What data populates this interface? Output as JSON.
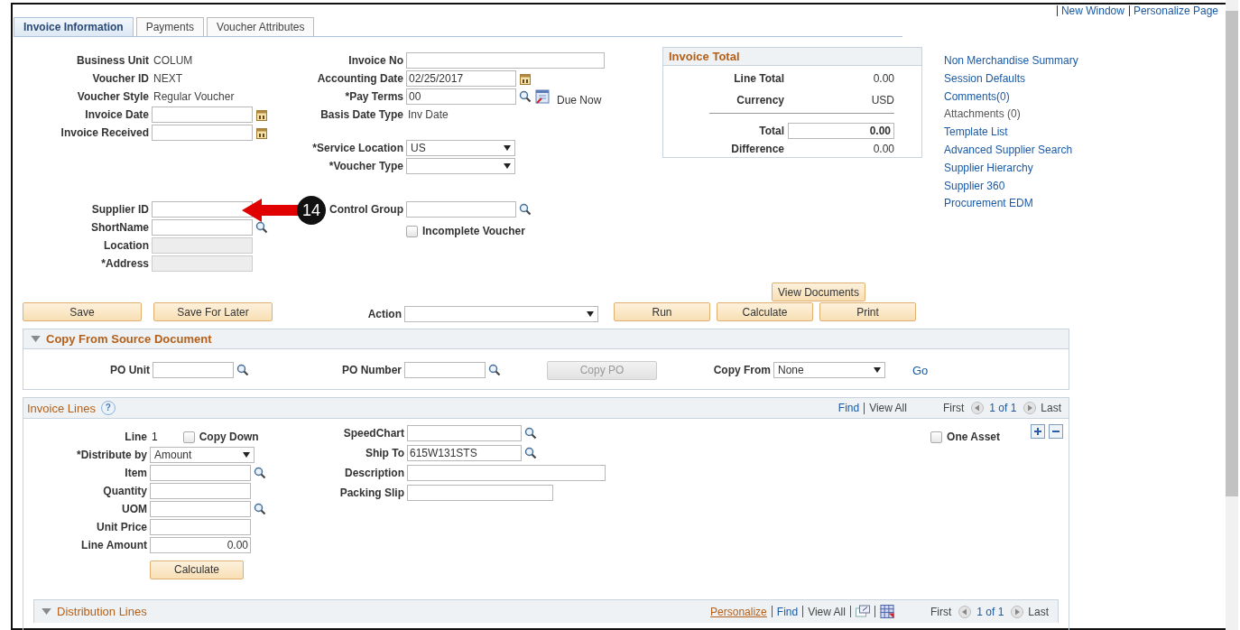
{
  "top_links": [
    "New Window",
    "Personalize Page"
  ],
  "tabs": [
    {
      "label": "Invoice Information",
      "selected": true
    },
    {
      "label": "Payments",
      "selected": false
    },
    {
      "label": "Voucher Attributes",
      "selected": false
    }
  ],
  "header": {
    "columns": [
      {
        "groups": [
          [
            {
              "kind": "text",
              "label": "Business Unit",
              "value": "COLUM"
            },
            {
              "kind": "text",
              "label": "Voucher ID",
              "value": "NEXT"
            },
            {
              "kind": "text",
              "label": "Voucher Style",
              "value": "Regular Voucher"
            },
            {
              "kind": "date",
              "label": "Invoice Date"
            },
            {
              "kind": "date",
              "label": "Invoice Received"
            }
          ],
          [
            {
              "kind": "input",
              "label": "Supplier ID"
            },
            {
              "kind": "lookup",
              "label": "ShortName"
            },
            {
              "kind": "disabled",
              "label": "Location"
            },
            {
              "kind": "disabled",
              "label": "*Address"
            }
          ]
        ]
      },
      {
        "groups": [
          [
            {
              "kind": "wide",
              "label": "Invoice No"
            },
            {
              "kind": "date",
              "label": "Accounting Date",
              "value": "02/25/2017"
            },
            {
              "kind": "terms",
              "label": "*Pay Terms",
              "value": "00",
              "note": "Due Now"
            },
            {
              "kind": "text",
              "label": "Basis Date Type",
              "value": "Inv Date"
            }
          ],
          [
            {
              "kind": "select",
              "label": "*Service Location",
              "value": "US"
            },
            {
              "kind": "select",
              "label": "*Voucher Type"
            }
          ],
          [
            {
              "kind": "lookup",
              "label": "Control Group"
            },
            {
              "kind": "checkbox",
              "label": "Incomplete Voucher",
              "checked": false
            }
          ]
        ]
      }
    ]
  },
  "invoice_total": {
    "title": "Invoice Total",
    "rows": [
      {
        "kind": "text",
        "label": "Line Total",
        "value": "0.00"
      },
      {
        "kind": "text",
        "label": "Currency",
        "value": "USD"
      },
      {
        "kind": "input",
        "label": "Total",
        "value": "0.00"
      },
      {
        "kind": "text",
        "label": "Difference",
        "value": "0.00"
      }
    ]
  },
  "side_links": [
    {
      "label": "Non Merchandise Summary",
      "disabled": false
    },
    {
      "label": "Session Defaults",
      "disabled": false
    },
    {
      "label": "Comments(0)",
      "disabled": false
    },
    {
      "label": "Attachments (0)",
      "disabled": true
    },
    {
      "label": "Template List",
      "disabled": false
    },
    {
      "label": "Advanced Supplier Search",
      "disabled": false
    },
    {
      "label": "Supplier Hierarchy",
      "disabled": false
    },
    {
      "label": "Supplier 360",
      "disabled": false
    },
    {
      "label": "Procurement EDM",
      "disabled": false
    }
  ],
  "actions": {
    "view_documents": "View Documents",
    "left_buttons": [
      "Save",
      "Save For Later"
    ],
    "action_label": "Action",
    "right_buttons": [
      "Run",
      "Calculate",
      "Print"
    ]
  },
  "copy_panel": {
    "title": "Copy From Source Document",
    "expanded": true,
    "po_unit": "PO Unit",
    "po_number": "PO Number",
    "copy_po": {
      "label": "Copy PO",
      "disabled": true
    },
    "copy_from": {
      "label": "Copy From",
      "value": "None"
    },
    "go": "Go"
  },
  "invoice_lines": {
    "title": "Invoice Lines",
    "help": "?",
    "nav": {
      "links": [
        {
          "label": "Find",
          "kind": "link"
        },
        {
          "label": "View All",
          "kind": "plain"
        }
      ],
      "first": "First",
      "count": "1 of 1",
      "last": "Last"
    },
    "columns": [
      {
        "groups": [
          [
            {
              "kind": "line",
              "label": "Line",
              "value": "1",
              "check_label": "Copy Down",
              "checked": false
            },
            {
              "kind": "select",
              "label": "*Distribute by",
              "value": "Amount"
            },
            {
              "kind": "lookup",
              "label": "Item"
            },
            {
              "kind": "input",
              "label": "Quantity"
            },
            {
              "kind": "lookup",
              "label": "UOM"
            },
            {
              "kind": "input",
              "label": "Unit Price"
            },
            {
              "kind": "amount",
              "label": "Line Amount",
              "value": "0.00"
            }
          ],
          [
            {
              "kind": "button",
              "label": "Calculate"
            }
          ]
        ]
      },
      {
        "groups": [
          [
            {
              "kind": "lookup",
              "label": "SpeedChart"
            },
            {
              "kind": "lookup",
              "label": "Ship To",
              "value": "615W131STS"
            },
            {
              "kind": "wide",
              "label": "Description"
            },
            {
              "kind": "long",
              "label": "Packing Slip"
            }
          ]
        ]
      }
    ],
    "one_asset": {
      "label": "One Asset",
      "checked": false
    },
    "distribution": {
      "title": "Distribution Lines",
      "expanded": true,
      "nav": {
        "links": [
          {
            "label": "Personalize",
            "kind": "accent"
          },
          {
            "label": "Find",
            "kind": "link"
          },
          {
            "label": "View All",
            "kind": "plain"
          }
        ],
        "first": "First",
        "count": "1 of 1",
        "last": "Last"
      }
    }
  },
  "callout": {
    "number": "14"
  }
}
